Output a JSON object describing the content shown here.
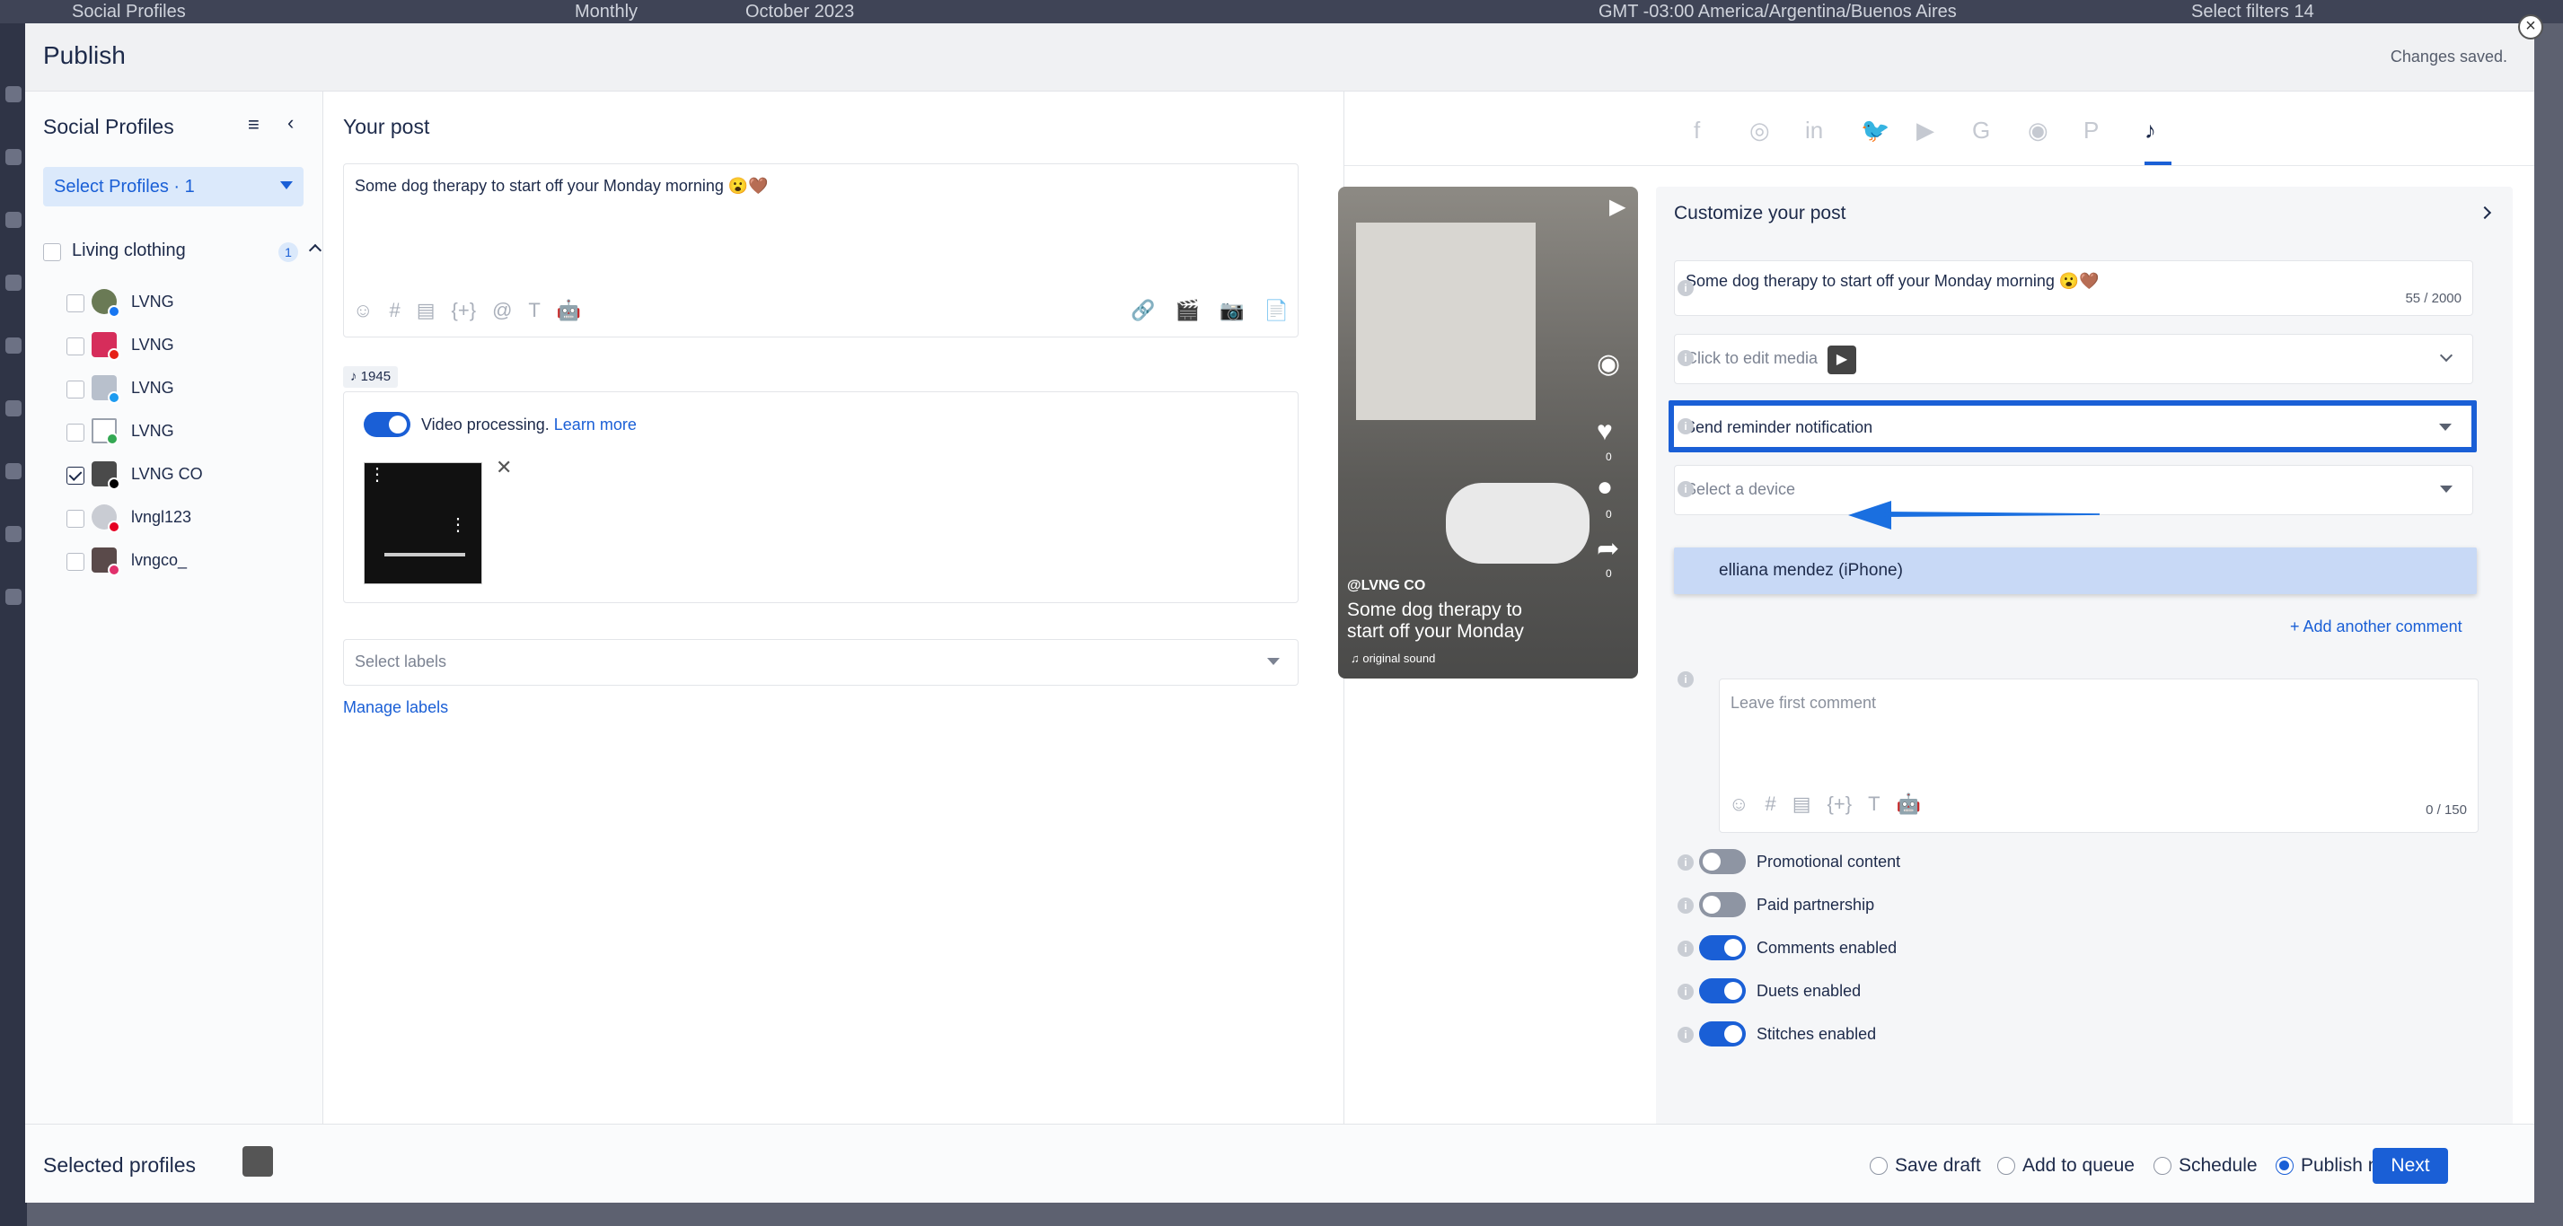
{
  "background": {
    "app_title": "Social Profiles",
    "view": "Monthly",
    "period": "October 2023",
    "timezone": "GMT -03:00 America/Argentina/Buenos Aires",
    "filters": "Select filters 14"
  },
  "modal": {
    "title": "Publish",
    "status": "Changes saved.",
    "close_icon": "×"
  },
  "left": {
    "title": "Social Profiles",
    "select_profiles": "Select Profiles · 1",
    "group": {
      "name": "Living clothing",
      "count": "1"
    },
    "profiles": [
      {
        "name": "LVNG",
        "network": "facebook",
        "checked": false
      },
      {
        "name": "LVNG",
        "network": "youtube",
        "checked": false
      },
      {
        "name": "LVNG",
        "network": "twitter",
        "checked": false
      },
      {
        "name": "LVNG",
        "network": "google",
        "checked": false
      },
      {
        "name": "LVNG CO",
        "network": "tiktok",
        "checked": true
      },
      {
        "name": "lvngl123",
        "network": "pinterest",
        "checked": false
      },
      {
        "name": "lvngco_",
        "network": "instagram",
        "checked": false
      }
    ]
  },
  "center": {
    "title": "Your post",
    "post_text": "Some dog therapy to start off your Monday morning 😮🤎",
    "toolbar_left": [
      "☺",
      "#",
      "▤",
      "{+}",
      "@",
      "T",
      "🤖"
    ],
    "toolbar_right": [
      "🔗",
      "🎬",
      "📷",
      "📄"
    ],
    "tiktok_count": "1945",
    "video_processing": "Video processing.",
    "learn_more": "Learn more",
    "labels_placeholder": "Select labels",
    "manage_labels": "Manage labels"
  },
  "networks": [
    "facebook",
    "instagram",
    "linkedin",
    "twitter",
    "youtube",
    "google",
    "reddit",
    "pinterest",
    "tiktok"
  ],
  "network_glyphs": [
    "f",
    "◎",
    "in",
    "🐦",
    "▶",
    "G",
    "◉",
    "P",
    "♪"
  ],
  "preview": {
    "handle": "@LVNG CO",
    "caption": "Some dog therapy to start off your Monday",
    "sound": "♫ original sound",
    "counts": [
      "0",
      "0",
      "0"
    ]
  },
  "customize": {
    "title": "Customize your post",
    "post_text": "Some dog therapy to start off your Monday morning 😮🤎",
    "char_count": "55 / 2000",
    "media_label": "Click to edit media",
    "reminder": "Send reminder notification",
    "device_placeholder": "Select a device",
    "device_option": "elliana mendez (iPhone)",
    "add_comment": "+ Add another comment",
    "first_comment_placeholder": "Leave first comment",
    "comment_count": "0 / 150",
    "toggles": [
      {
        "label": "Promotional content",
        "on": false
      },
      {
        "label": "Paid partnership",
        "on": false
      },
      {
        "label": "Comments enabled",
        "on": true
      },
      {
        "label": "Duets enabled",
        "on": true
      },
      {
        "label": "Stitches enabled",
        "on": true
      }
    ]
  },
  "footer": {
    "selected_profiles": "Selected profiles",
    "options": [
      {
        "label": "Save draft",
        "selected": false
      },
      {
        "label": "Add to queue",
        "selected": false
      },
      {
        "label": "Schedule",
        "selected": false
      },
      {
        "label": "Publish now",
        "selected": true
      }
    ],
    "next": "Next"
  },
  "colors": {
    "accent": "#1a5fd6",
    "text": "#1d2a4a",
    "muted": "#8e95a3"
  }
}
